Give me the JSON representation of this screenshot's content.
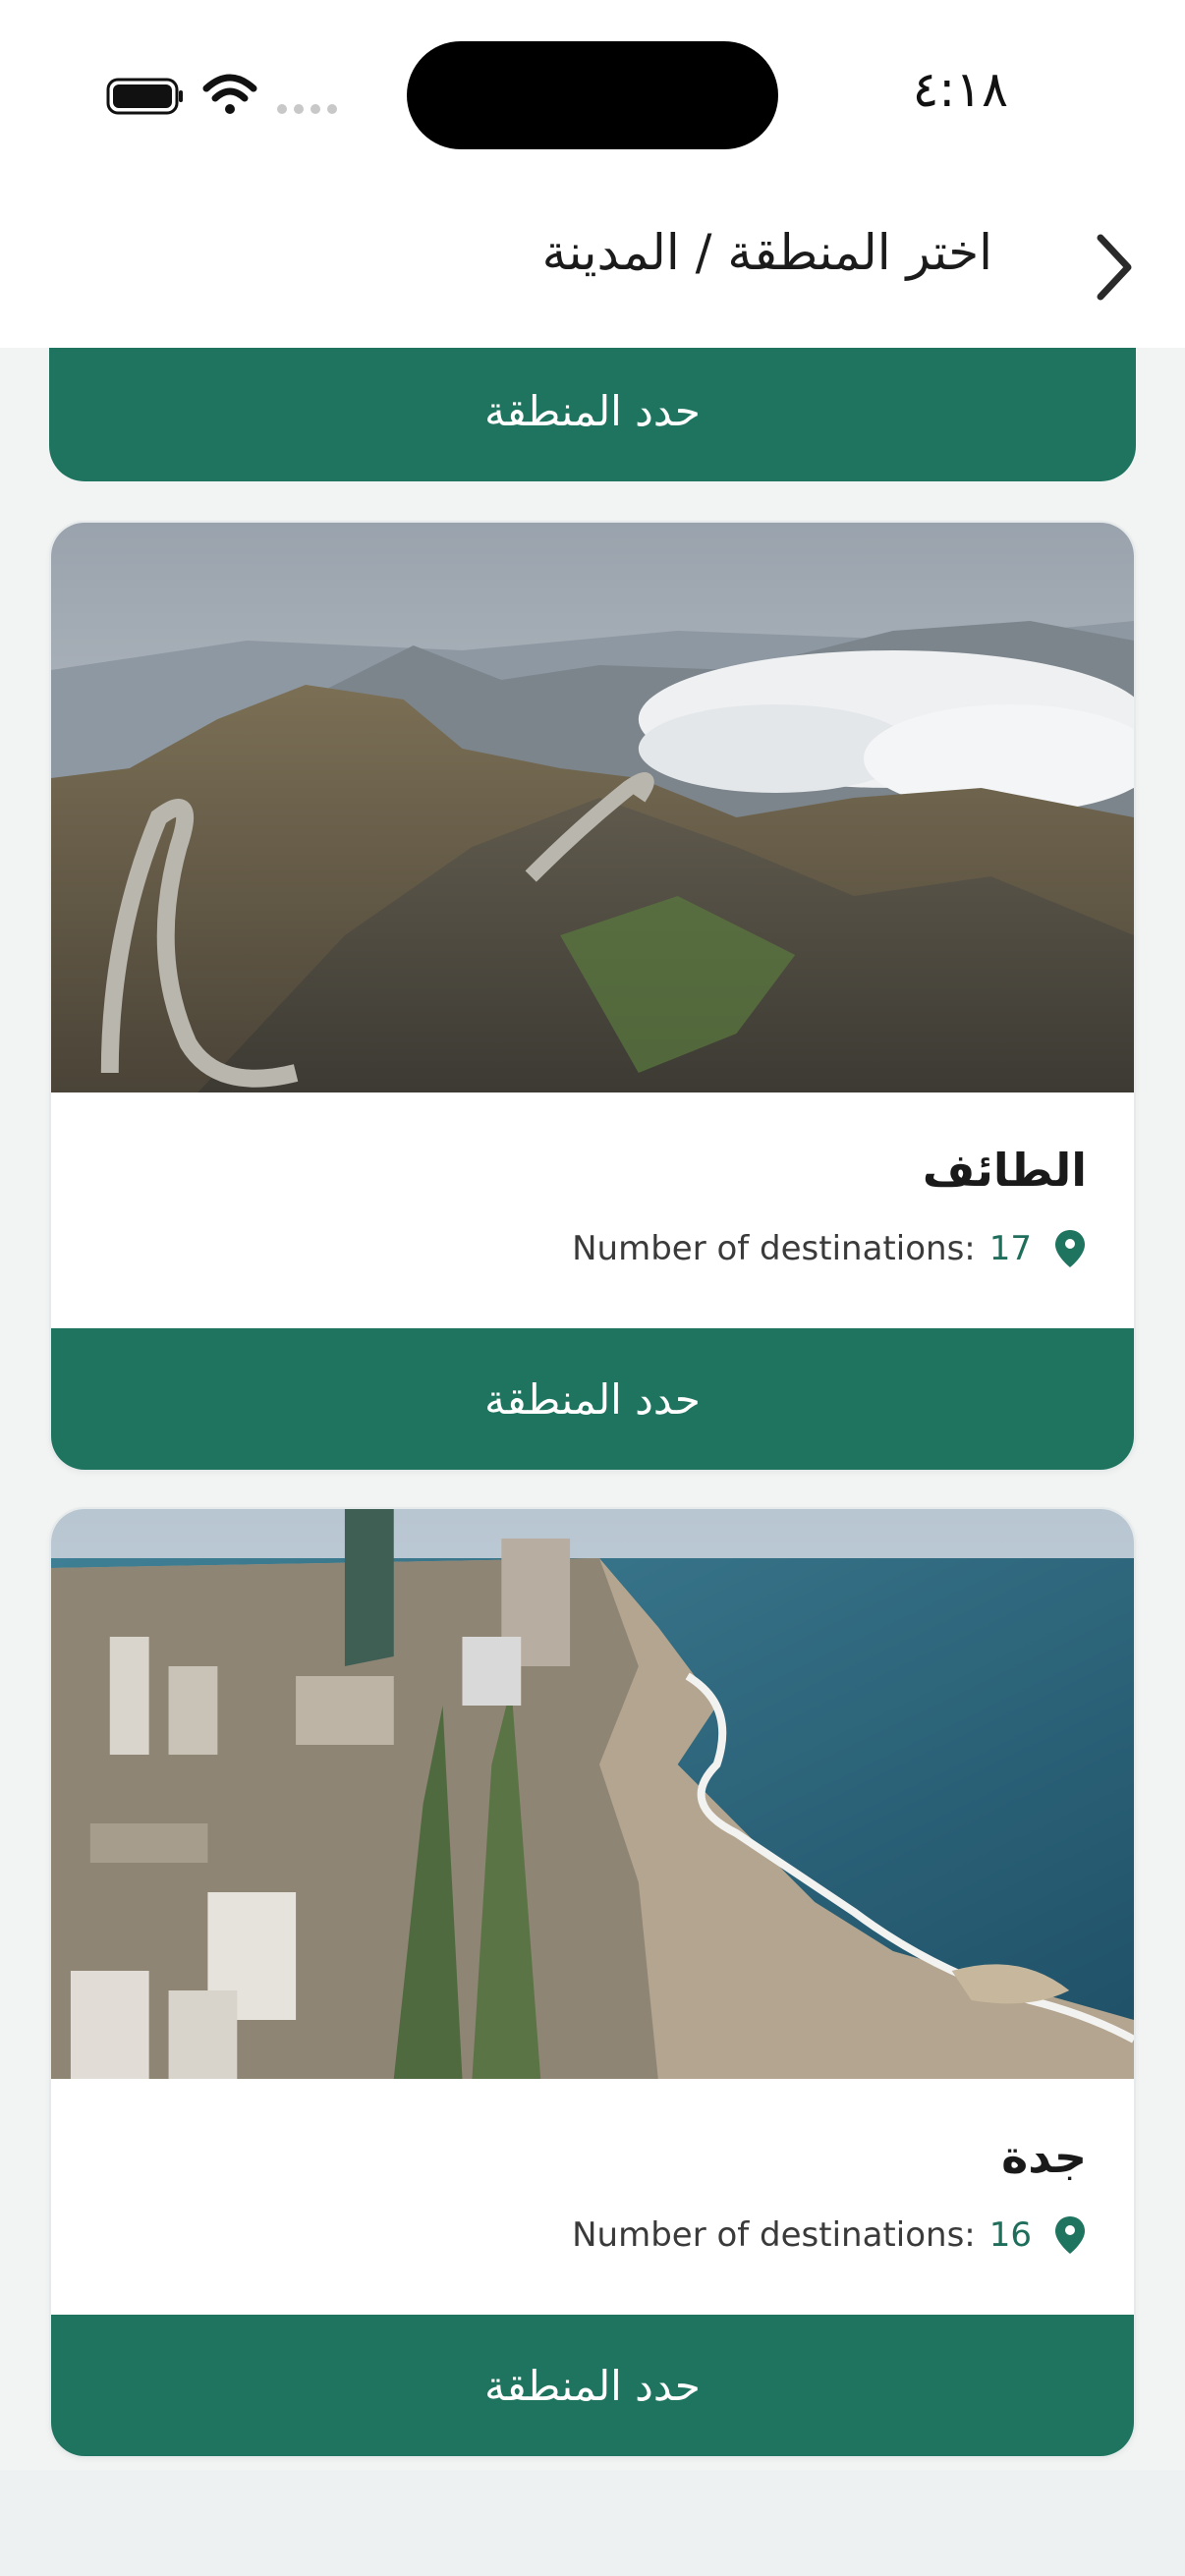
{
  "status_bar": {
    "time": "٤:١٨",
    "icons": [
      "battery-icon",
      "wifi-icon",
      "cellular-signal-icon"
    ]
  },
  "header": {
    "title": "اختر المنطقة / المدينة",
    "back_icon": "chevron-right-icon"
  },
  "cards": [
    {
      "name": "",
      "button_label": "حدد المنطقة"
    },
    {
      "name": "الطائف",
      "destinations_label": "Number of destinations:",
      "destinations_count": "17",
      "button_label": "حدد المنطقة",
      "image": "mountain-road-photo"
    },
    {
      "name": "جدة",
      "destinations_label": "Number of destinations:",
      "destinations_count": "16",
      "button_label": "حدد المنطقة",
      "image": "coastal-city-photo"
    }
  ],
  "colors": {
    "accent": "#1f7460",
    "background": "#f2f4f4",
    "count_text": "#1f6e5c"
  }
}
